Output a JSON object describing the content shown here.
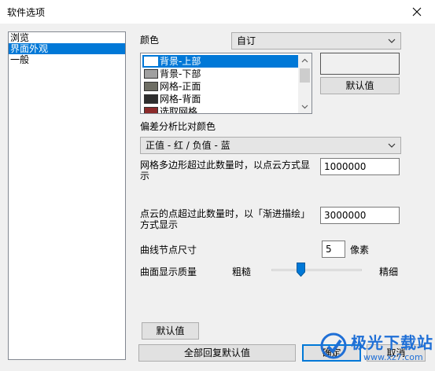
{
  "window": {
    "title": "软件选项"
  },
  "nav": {
    "items": [
      "浏览",
      "界面外观",
      "一般"
    ],
    "selected_index": 1
  },
  "color": {
    "label": "颜色",
    "mode_value": "自订",
    "items": [
      {
        "label": "背景-上部",
        "swatch": "#ffffff"
      },
      {
        "label": "背景-下部",
        "swatch": "#a0a0a0"
      },
      {
        "label": "网格-正面",
        "swatch": "#6e6e64"
      },
      {
        "label": "网格-背面",
        "swatch": "#2e2e2e"
      },
      {
        "label": "选取网格",
        "swatch": "#8b2a2a"
      }
    ],
    "selected_index": 0,
    "preview_color": "#f0f0f0",
    "default_button": "默认值"
  },
  "deviation": {
    "label": "偏差分析比对颜色",
    "value": "正值 - 红 / 负值 - 蓝"
  },
  "mesh_threshold": {
    "label_line1": "网格多边形超过此数量时，以点云方式显",
    "label_line2": "示",
    "value": "1000000"
  },
  "cloud_threshold": {
    "label_line1": "点云的点超过此数量时，以「渐进描绘」",
    "label_line2": "方式显示",
    "value": "3000000"
  },
  "curve_node": {
    "label": "曲线节点尺寸",
    "value": "5",
    "unit": "像素"
  },
  "surface_quality": {
    "label": "曲面显示质量",
    "min_label": "粗糙",
    "max_label": "精细",
    "level": 0.33
  },
  "buttons": {
    "panel_default": "默认值",
    "restore_all": "全部回复默认值",
    "ok": "确定",
    "cancel": "取消"
  },
  "watermark": {
    "brand": "极光下载站",
    "url": "www.xz7.com"
  },
  "colors": {
    "accent": "#0078d7",
    "watermark": "#1f6fd6"
  }
}
